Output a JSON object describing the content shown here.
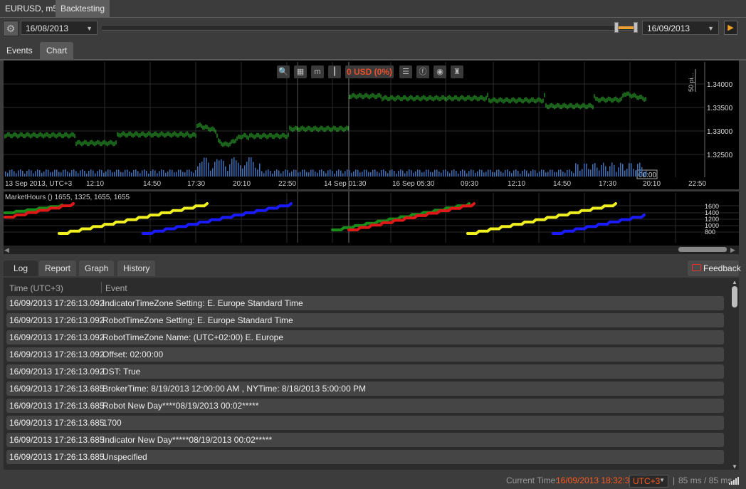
{
  "window_tabs": [
    "EURUSD, m5",
    "Backtesting"
  ],
  "toolbar": {
    "gear_icon": "gear-icon",
    "start_date": "16/08/2013",
    "end_date": "16/09/2013",
    "play_icon": "play-icon"
  },
  "view_tabs": [
    "Events",
    "Chart"
  ],
  "chart": {
    "pnl_label": "0 USD (0%)",
    "scale_label": "50 pi...",
    "price_ticks": [
      "1.34000",
      "1.33500",
      "1.33000",
      "1.32500"
    ],
    "time_ticks": [
      "13 Sep 2013, UTC+3",
      "12:10",
      "14:50",
      "17:30",
      "20:10",
      "22:50",
      "14 Sep 01:30",
      "16 Sep 05:30",
      "09:30",
      "12:10",
      "14:50",
      "17:30",
      "20:10",
      "22:50"
    ],
    "cursor_time": "00:00",
    "indicator_label": "MarketHours () 1655, 1325, 1655, 1655",
    "indicator_ticks": [
      "1600",
      "1400",
      "1200",
      "1000",
      "800"
    ],
    "series_colors": {
      "price": "#34c434",
      "volume": "#3f6fb7",
      "green_line": "#1a8c1a",
      "red_line": "#e01818",
      "yellow_line": "#f0f020",
      "blue_line": "#1a1aff"
    }
  },
  "bottom_tabs": [
    "Log",
    "Report",
    "Graph",
    "History"
  ],
  "feedback_label": "Feedback",
  "log": {
    "columns": [
      "Time (UTC+3)",
      "Event"
    ],
    "rows": [
      {
        "time": "16/09/2013 17:26:13.092",
        "event": "IndicatorTimeZone Setting: E. Europe Standard Time"
      },
      {
        "time": "16/09/2013 17:26:13.092",
        "event": "RobotTimeZone Setting: E. Europe Standard Time"
      },
      {
        "time": "16/09/2013 17:26:13.092",
        "event": "RobotTimeZone Name: (UTC+02:00) E. Europe"
      },
      {
        "time": "16/09/2013 17:26:13.092",
        "event": "Offset: 02:00:00"
      },
      {
        "time": "16/09/2013 17:26:13.092",
        "event": "DST: True"
      },
      {
        "time": "16/09/2013 17:26:13.685",
        "event": "BrokerTime: 8/19/2013 12:00:00 AM , NYTime: 8/18/2013 5:00:00 PM"
      },
      {
        "time": "16/09/2013 17:26:13.685",
        "event": "Robot New Day****08/19/2013 00:02*****"
      },
      {
        "time": "16/09/2013 17:26:13.685",
        "event": "1700"
      },
      {
        "time": "16/09/2013 17:26:13.685",
        "event": "Indicator New Day*****08/19/2013 00:02*****"
      },
      {
        "time": "16/09/2013 17:26:13.685",
        "event": "Unspecified"
      }
    ]
  },
  "status": {
    "current_time_label": "Current Time:",
    "current_time": "16/09/2013 18:32:31",
    "timezone": "UTC+3",
    "latency": "85 ms / 85 ms",
    "accent_color": "#ff5a1e"
  }
}
